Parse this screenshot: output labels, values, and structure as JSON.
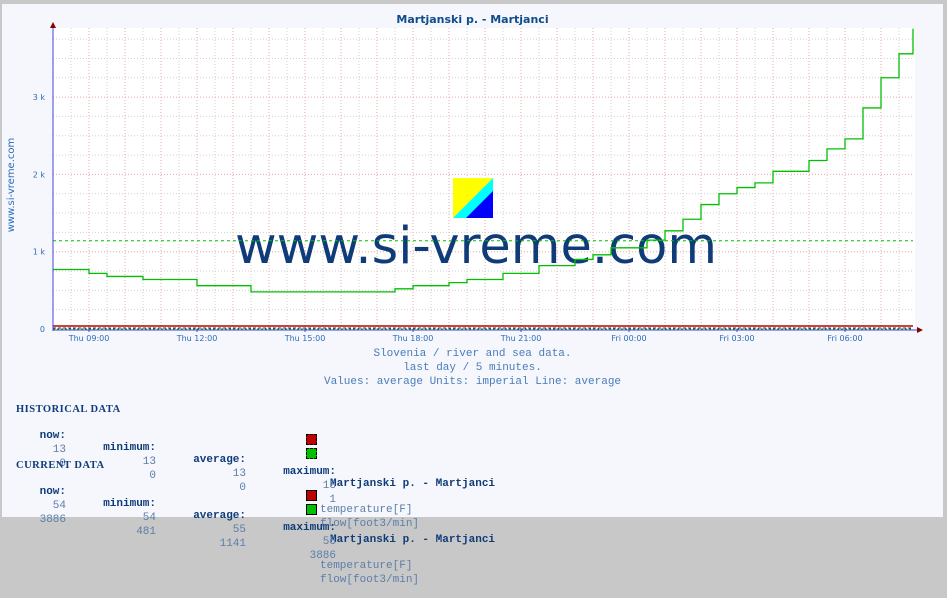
{
  "title": "Martjanski p. - Martjanci",
  "side_label": "www.si-vreme.com",
  "watermark": "www.si-vreme.com",
  "info_lines": [
    "Slovenia / river and sea data.",
    "last day / 5 minutes.",
    "Values: average  Units: imperial  Line: average"
  ],
  "colors": {
    "flow": "#00c000",
    "temperature": "#c00000",
    "axis_y": "#4444dd",
    "axis_x": "#880000",
    "watermark": "#0f3c78",
    "text_blue": "#2a6db8"
  },
  "chart_data": {
    "type": "line",
    "title": "Martjanski p. - Martjanci",
    "xlabel": "",
    "ylabel": "",
    "x_unit": "hours since Thu 08:00",
    "xlim": [
      0,
      23.9
    ],
    "ylim": [
      0,
      3900
    ],
    "grid": true,
    "x_ticks": [
      {
        "label": "Thu 09:00",
        "x": 1
      },
      {
        "label": "Thu 12:00",
        "x": 4
      },
      {
        "label": "Thu 15:00",
        "x": 7
      },
      {
        "label": "Thu 18:00",
        "x": 10
      },
      {
        "label": "Thu 21:00",
        "x": 13
      },
      {
        "label": "Fri 00:00",
        "x": 16
      },
      {
        "label": "Fri 03:00",
        "x": 19
      },
      {
        "label": "Fri 06:00",
        "x": 22
      }
    ],
    "y_ticks": [
      {
        "label": "0",
        "y": 0
      },
      {
        "label": "1 k",
        "y": 1000
      },
      {
        "label": "2 k",
        "y": 2000
      },
      {
        "label": "3 k",
        "y": 3000
      }
    ],
    "series": [
      {
        "name": "flow[foot3/min]",
        "color": "#00c000",
        "step": true,
        "points": [
          [
            0,
            770
          ],
          [
            1,
            720
          ],
          [
            1.5,
            680
          ],
          [
            2.5,
            640
          ],
          [
            4,
            560
          ],
          [
            5.5,
            480
          ],
          [
            9.5,
            520
          ],
          [
            10,
            560
          ],
          [
            11,
            600
          ],
          [
            11.5,
            640
          ],
          [
            12.5,
            720
          ],
          [
            13.5,
            820
          ],
          [
            14.5,
            900
          ],
          [
            15,
            960
          ],
          [
            15.5,
            1050
          ],
          [
            16.5,
            1150
          ],
          [
            17,
            1270
          ],
          [
            17.5,
            1420
          ],
          [
            18,
            1610
          ],
          [
            18.5,
            1750
          ],
          [
            19,
            1830
          ],
          [
            19.5,
            1890
          ],
          [
            20,
            2040
          ],
          [
            21,
            2180
          ],
          [
            21.5,
            2330
          ],
          [
            22,
            2460
          ],
          [
            22.5,
            2860
          ],
          [
            23,
            3250
          ],
          [
            23.5,
            3560
          ],
          [
            24,
            3886
          ]
        ],
        "average": 1141
      },
      {
        "name": "temperature[F]",
        "color": "#c00000",
        "flat_value": 55,
        "average": 55
      }
    ],
    "legend": "bottom"
  },
  "historical": {
    "title": "HISTORICAL DATA",
    "headers": [
      "now:",
      "minimum:",
      "average:",
      "maximum:",
      "Martjanski p. - Martjanci"
    ],
    "rows": [
      {
        "now": "13",
        "min": "13",
        "avg": "13",
        "max": "13",
        "label": "temperature[F]",
        "color": "#c00000"
      },
      {
        "now": "0",
        "min": "0",
        "avg": "0",
        "max": "1",
        "label": "flow[foot3/min]",
        "color": "#00c000"
      }
    ]
  },
  "current": {
    "title": "CURRENT DATA",
    "headers": [
      "now:",
      "minimum:",
      "average:",
      "maximum:",
      "Martjanski p. - Martjanci"
    ],
    "rows": [
      {
        "now": "54",
        "min": "54",
        "avg": "55",
        "max": "55",
        "label": "temperature[F]",
        "color": "#c00000"
      },
      {
        "now": "3886",
        "min": "481",
        "avg": "1141",
        "max": "3886",
        "label": "flow[foot3/min]",
        "color": "#00c000"
      }
    ]
  }
}
